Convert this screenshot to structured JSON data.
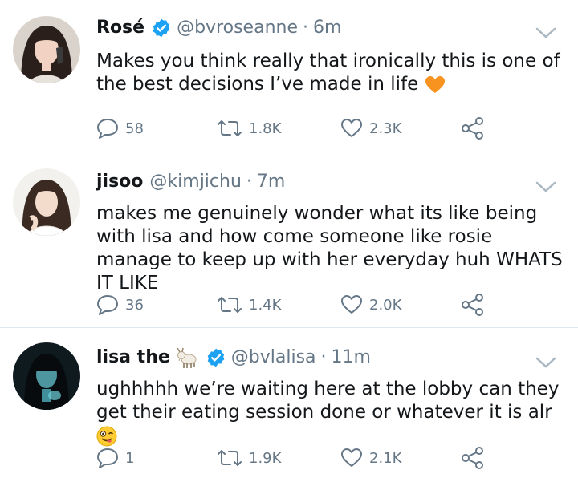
{
  "tweets": [
    {
      "name": "Rosé",
      "verified": true,
      "handle": "@bvroseanne",
      "separator": "·",
      "time": "6m",
      "text": "Makes you think really that ironically this is one of the best decisions I’ve made in life",
      "emoji": "orange-heart",
      "replies": "58",
      "retweets": "1.8K",
      "likes": "2.3K"
    },
    {
      "name": "jisoo",
      "verified": false,
      "handle": "@kimjichu",
      "separator": "·",
      "time": "7m",
      "text": "makes me genuinely wonder what its like being with lisa and how come someone like rosie manage to keep up with her everyday huh WHATS IT LIKE",
      "replies": "36",
      "retweets": "1.4K",
      "likes": "2.0K"
    },
    {
      "name": "lisa the",
      "name_emoji": "goat-icon",
      "verified": true,
      "handle": "@bvlalisa",
      "separator": "·",
      "time": "11m",
      "text": "ughhhhh we’re waiting here at the lobby can they get their eating session done or whatever it is alr",
      "emoji": "winking-tongue-face",
      "replies": "1",
      "retweets": "1.9K",
      "likes": "2.1K"
    }
  ],
  "colors": {
    "verified": "#1da1f2",
    "text": "#14171a",
    "muted": "#657786",
    "divider": "#e1e8ed"
  }
}
